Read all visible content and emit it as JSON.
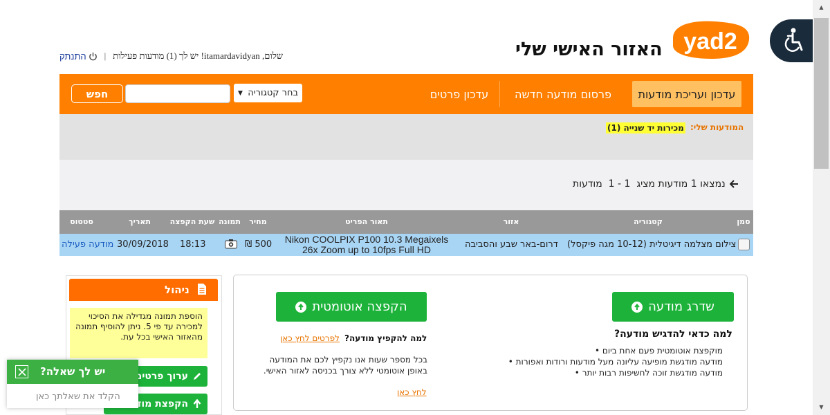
{
  "header": {
    "logo_text": "yad2",
    "page_title": "האזור האישי שלי",
    "greeting": "שלום, itamardavidyan! יש לך (1) מודעות פעילות",
    "separator": "|",
    "logout_label": "התנתק"
  },
  "nav": {
    "items": [
      "עדכון ועריכת מודעות",
      "פרסום מודעה חדשה",
      "עדכון פרטים"
    ],
    "category_select": "בחר קטגוריה",
    "search_placeholder": "",
    "search_button": "חפש"
  },
  "my_ads": {
    "label": "המודעות שלי:",
    "chip": "מכירות יד שנייה (1)"
  },
  "results": {
    "text": "נמצאו 1 מודעות מציג  1 - 1  מודעות"
  },
  "table": {
    "headers": [
      "סמן",
      "קטגוריה",
      "אזור",
      "תאור הפריט",
      "מחיר",
      "תמונה",
      "שעת הקפצה",
      "תאריך",
      "סטטוס"
    ],
    "rows": [
      {
        "category": "צילום מצלמה דיגיטלית (10-12 מגה פיקסל)",
        "area": "דרום-באר שבע והסביבה",
        "description_line1": "Nikon COOLPIX P100 10.3 Megaixels",
        "description_line2": "26x Zoom up to 10fps Full HD",
        "price": "500 ₪",
        "bump_time": "18:13",
        "date": "30/09/2018",
        "status": "מודעה פעילה"
      }
    ]
  },
  "promo": {
    "upgrade_button": "שדרג מודעה",
    "upgrade_heading": "למה כדאי להדגיש מודעה?",
    "upgrade_bullets": [
      "מוקפצת אוטומטית פעם אחת ביום",
      "מודעה מודגשת מופיעה עליונה מעל מודעות ורודות ואפורות",
      "מודעה מודגשת זוכה לחשיפות רבות יותר"
    ],
    "bump_button": "הקפצה אוטומטית",
    "bump_heading": "למה להקפיץ מודעה?",
    "bump_details_link": "לפרטים לחץ כאן",
    "bump_body_line1": "בכל מספר שעות אנו נקפיץ לכם את המודעה",
    "bump_body_line2": "באופן אוטומטי ללא צורך בכניסה לאזור האישי.",
    "click_here": "לחץ כאן"
  },
  "manage": {
    "title": "ניהול",
    "tip": "הוספת תמונה מגדילה את הסיכוי למכירה עד פי 5. ניתן להוסיף תמונה מהאזור האישי בכל עת.",
    "edit_button": "ערוך פרטים",
    "bump_button": "הקפצת מודעה"
  },
  "chat": {
    "title": "יש לך שאלה?",
    "input_placeholder": "הקלד את שאלתך כאן"
  },
  "colors": {
    "brand_orange": "#ff7f00",
    "active_tab": "#ffc061",
    "row_highlight": "#a9d5f5",
    "green": "#1db33a",
    "highlight_yellow": "#ffff33"
  }
}
